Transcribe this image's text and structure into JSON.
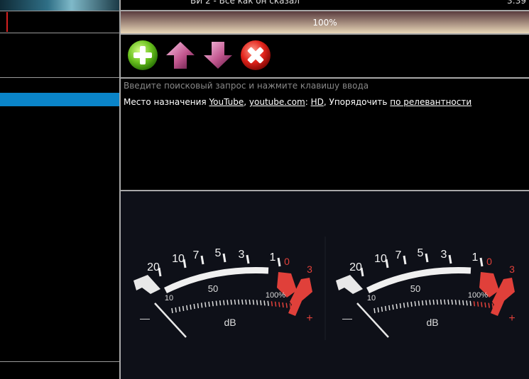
{
  "now_playing": {
    "title": "ВИ 2 - Все как он сказал",
    "time": "3:39"
  },
  "progress": {
    "label": "100%",
    "value": 100
  },
  "toolbar": {
    "add_icon": "plus-circle-icon",
    "up_icon": "arrow-up-icon",
    "down_icon": "arrow-down-icon",
    "remove_icon": "close-circle-icon"
  },
  "search": {
    "hint": "Введите поисковый запрос и нажмите клавишу ввода",
    "destination_label": "Место назначения",
    "destination_service": "YouTube",
    "destination_site": "youtube.com",
    "quality": "HD",
    "sort_label": "Упорядочить",
    "sort_value": "по релевантности",
    "sep_comma": ",",
    "sep_colon": ":"
  },
  "vu_meter": {
    "scale_labels": [
      "20",
      "10",
      "7",
      "5",
      "3",
      "1"
    ],
    "red_labels": [
      "0",
      "3"
    ],
    "mid_label": "50",
    "low_label": "10",
    "percent_label": "100%",
    "unit": "dB",
    "minus": "—",
    "plus": "+"
  },
  "colors": {
    "selection": "#0a84c8",
    "vu_red": "#e0403a",
    "panel": "#0e1018"
  }
}
